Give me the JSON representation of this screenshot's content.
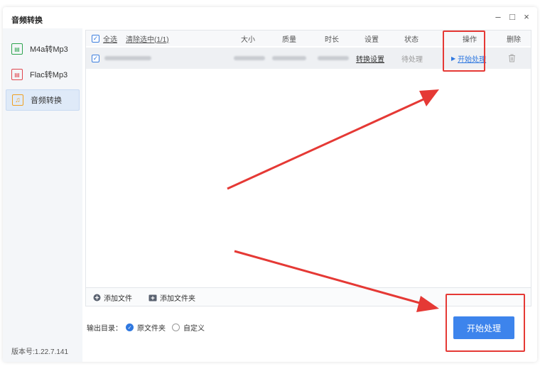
{
  "window": {
    "title": "音频转换",
    "controls": [
      "–",
      "□",
      "×"
    ]
  },
  "sidebar": {
    "items": [
      {
        "label": "M4a转Mp3",
        "icon": "m4a-file-icon",
        "color": "#2ea44f"
      },
      {
        "label": "Flac转Mp3",
        "icon": "flac-file-icon",
        "color": "#e0464e"
      },
      {
        "label": "音频转换",
        "icon": "music-note-icon",
        "color": "#f0a020"
      }
    ],
    "active_index": 2,
    "version": "版本号:1.22.7.141"
  },
  "table": {
    "select_all": "全选",
    "clear_selected": "清除选中(1/1)",
    "columns": {
      "size": "大小",
      "quality": "质量",
      "duration": "时长",
      "settings": "设置",
      "status": "状态",
      "action": "操作",
      "delete": "删除"
    },
    "rows": [
      {
        "settings_link": "转换设置",
        "status": "待处理",
        "action_link": "开始处理"
      }
    ]
  },
  "footer": {
    "add_file": "添加文件",
    "add_folder": "添加文件夹"
  },
  "output": {
    "label": "输出目录：",
    "option_source": "原文件夹",
    "option_custom": "自定义",
    "selected": "原文件夹"
  },
  "start_button": "开始处理",
  "colors": {
    "accent": "#3d84ec",
    "annotation": "#e53935"
  }
}
